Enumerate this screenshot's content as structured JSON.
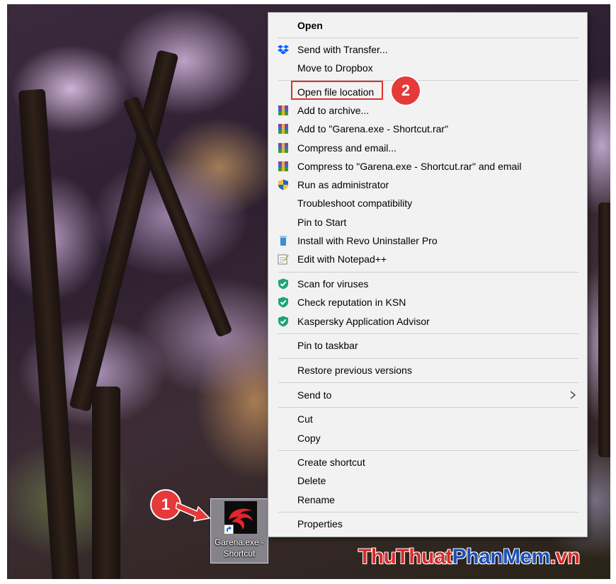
{
  "menu": {
    "items": [
      {
        "label": "Open",
        "bold": true,
        "icon": ""
      },
      {
        "label": "Send with Transfer...",
        "icon": "dropbox-icon"
      },
      {
        "label": "Move to Dropbox",
        "icon": ""
      },
      {
        "label": "Open file location",
        "icon": ""
      },
      {
        "label": "Add to archive...",
        "icon": "winrar-icon"
      },
      {
        "label": "Add to \"Garena.exe - Shortcut.rar\"",
        "icon": "winrar-icon"
      },
      {
        "label": "Compress and email...",
        "icon": "winrar-icon"
      },
      {
        "label": "Compress to \"Garena.exe - Shortcut.rar\" and email",
        "icon": "winrar-icon"
      },
      {
        "label": "Run as administrator",
        "icon": "uac-shield-icon"
      },
      {
        "label": "Troubleshoot compatibility",
        "icon": ""
      },
      {
        "label": "Pin to Start",
        "icon": ""
      },
      {
        "label": "Install with Revo Uninstaller Pro",
        "icon": "revo-uninstaller-icon"
      },
      {
        "label": "Edit with Notepad++",
        "icon": "notepad-plus-plus-icon"
      },
      {
        "label": "Scan for viruses",
        "icon": "kaspersky-icon"
      },
      {
        "label": "Check reputation in KSN",
        "icon": "kaspersky-icon"
      },
      {
        "label": "Kaspersky Application Advisor",
        "icon": "kaspersky-icon"
      },
      {
        "label": "Pin to taskbar",
        "icon": ""
      },
      {
        "label": "Restore previous versions",
        "icon": ""
      },
      {
        "label": "Send to",
        "icon": "",
        "submenu": true
      },
      {
        "label": "Cut",
        "icon": ""
      },
      {
        "label": "Copy",
        "icon": ""
      },
      {
        "label": "Create shortcut",
        "icon": ""
      },
      {
        "label": "Delete",
        "icon": ""
      },
      {
        "label": "Rename",
        "icon": ""
      },
      {
        "label": "Properties",
        "icon": ""
      }
    ]
  },
  "annotations": {
    "step1": "1",
    "step2": "2",
    "highlight_color": "#e0302b",
    "badge_color": "#e5393a"
  },
  "desktop_icon": {
    "caption_line1": "Garena.exe -",
    "caption_line2": "Shortcut",
    "icon": "garena-icon"
  },
  "watermark": {
    "part1": "ThuThuat",
    "part2": "PhanMem",
    "part3": ".vn"
  }
}
